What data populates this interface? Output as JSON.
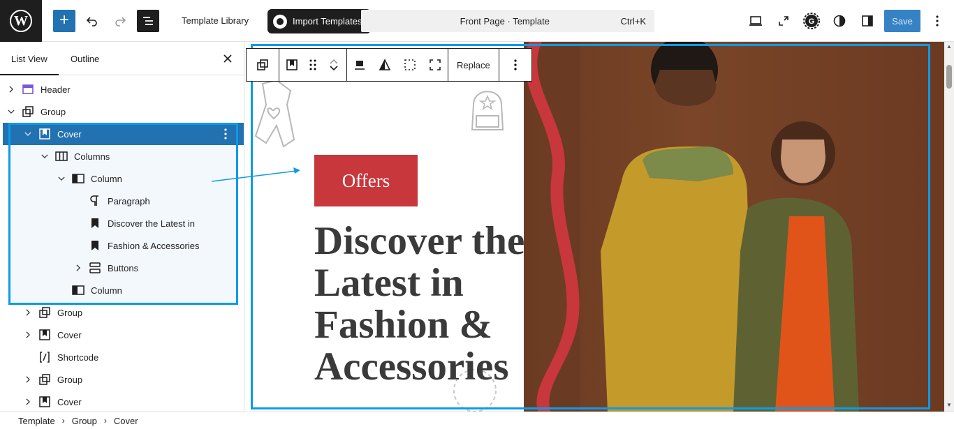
{
  "topbar": {
    "wp_logo_letter": "W",
    "add_block_label": "+",
    "template_library": "Template Library",
    "import_templates": "Import Templates",
    "command_title": "Front Page · Template",
    "command_shortcut": "Ctrl+K",
    "save_label": "Save"
  },
  "sidebar": {
    "tabs": [
      "List View",
      "Outline"
    ],
    "items": [
      {
        "label": "Header",
        "icon": "template-part-icon",
        "depth": 0,
        "expand": "collapsed"
      },
      {
        "label": "Group",
        "icon": "group-icon",
        "depth": 0,
        "expand": "expanded"
      },
      {
        "label": "Cover",
        "icon": "cover-icon",
        "depth": 1,
        "expand": "expanded"
      },
      {
        "label": "Columns",
        "icon": "columns-icon",
        "depth": 2,
        "expand": "expanded"
      },
      {
        "label": "Column",
        "icon": "column-icon",
        "depth": 3,
        "expand": "expanded"
      },
      {
        "label": "Paragraph",
        "icon": "paragraph-icon",
        "depth": 4,
        "expand": "none"
      },
      {
        "label": "Discover the Latest in",
        "icon": "bookmark-icon",
        "depth": 4,
        "expand": "none"
      },
      {
        "label": "Fashion & Accessories",
        "icon": "bookmark-icon",
        "depth": 4,
        "expand": "none"
      },
      {
        "label": "Buttons",
        "icon": "buttons-icon",
        "depth": 4,
        "expand": "collapsed"
      },
      {
        "label": "Column",
        "icon": "column-icon",
        "depth": 3,
        "expand": "none"
      },
      {
        "label": "Group",
        "icon": "group-icon",
        "depth": 1,
        "expand": "collapsed"
      },
      {
        "label": "Cover",
        "icon": "cover-icon",
        "depth": 1,
        "expand": "collapsed"
      },
      {
        "label": "Shortcode",
        "icon": "shortcode-icon",
        "depth": 1,
        "expand": "none"
      },
      {
        "label": "Group",
        "icon": "group-icon",
        "depth": 1,
        "expand": "collapsed"
      },
      {
        "label": "Cover",
        "icon": "cover-icon",
        "depth": 1,
        "expand": "collapsed"
      }
    ]
  },
  "block_toolbar": {
    "replace_label": "Replace"
  },
  "canvas": {
    "offers_label": "Offers",
    "headline_lines": [
      "Discover the",
      "Latest in",
      "Fashion &",
      "Accessories"
    ]
  },
  "breadcrumb": [
    "Template",
    "Group",
    "Cover"
  ],
  "colors": {
    "accent": "#2271b1",
    "selection": "#0d9ae8",
    "offers_bg": "#c7373c",
    "headline": "#3a3a3a"
  }
}
